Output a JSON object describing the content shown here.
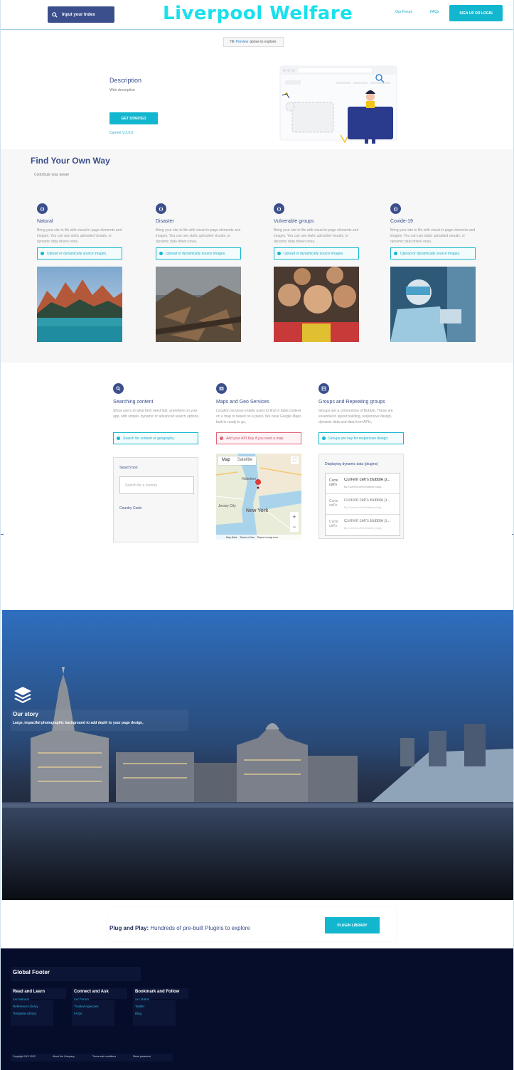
{
  "header": {
    "search_label": "Input your Index",
    "brand": "Liverpool Welfare",
    "nav": [
      "Our Forum",
      "FAQs"
    ],
    "signup_label": "SIGN UP OR LOGIN"
  },
  "notice": {
    "prefix": "Hit",
    "link": "Preview",
    "suffix": "above to explore."
  },
  "hero": {
    "title": "Description",
    "subtitle": "Web description",
    "button": "GET STARTED",
    "version": "Current V.3.0.0"
  },
  "find": {
    "title": "Find Your Own Way",
    "subtitle": "Contribute your power",
    "cards": [
      {
        "title": "Natural",
        "desc": "Bring your site to life with visual in-page elements and images, You can use static uploaded visuals, or dynamic data driven ones,",
        "info": "Upload or dynamically source images."
      },
      {
        "title": "Disaster",
        "desc": "Bring your site to life with visual in-page elements and images, You can use static uploaded visuals, or dynamic data driven ones,",
        "info": "Upload or dynamically source images."
      },
      {
        "title": "Vulnerable groups",
        "desc": "Bring your site to life with visual in-page elements and images, You can use static uploaded visuals, or dynamic data driven ones,",
        "info": "Upload or dynamically source images."
      },
      {
        "title": "Covide-19",
        "desc": "Bring your site to life with visual in-page elements and images, You can use static uploaded visuals, or dynamic data driven ones,",
        "info": "Upload or dynamically source images."
      }
    ]
  },
  "features": {
    "search": {
      "title": "Searching content",
      "desc": "Show users to what they need fast, anywhere on your app, with simple, dynamic or advanced search options,",
      "info": "Search for content or geography.",
      "box_label": "Search box:",
      "placeholder": "Search for a country",
      "country_label": "Country Code:"
    },
    "maps": {
      "title": "Maps and Geo Services",
      "desc": "Location services enable users to find or label content on a map or based on a place, We have Google Maps built in ready to go,",
      "warn": "Add your API Key if you need a map.",
      "tab_map": "Map",
      "tab_sat": "Satellite",
      "zoom_in": "+",
      "zoom_out": "−",
      "labels": {
        "hoboken": "Hoboken",
        "jersey": "Jersey City",
        "ny": "New York"
      },
      "footer": [
        "Map Data",
        "Terms of Use",
        "Report a map error"
      ]
    },
    "groups": {
      "title": "Groups and Repeating groups",
      "desc": "Groups are a cornerstone of Bubble, These are essential to layout building, responsive design, dynamic data and data from APIs,",
      "info": "Groups are key for responsive design.",
      "panel_title": "Displaying dynamic data (plugins)",
      "rows": [
        {
          "key": "Curre cell's",
          "title": "Current cell's Bubble p...",
          "sub": "By Current cell's Bubble plugi..."
        },
        {
          "key": "Curre cell's",
          "title": "Current cell's Bubble p...",
          "sub": "By Current cell's Bubble plugi..."
        },
        {
          "key": "Curre cell's",
          "title": "Current cell's Bubble p...",
          "sub": "By Current cell's Bubble plugi..."
        }
      ]
    }
  },
  "story": {
    "title": "Our story",
    "subtitle": "Large, impactful photographic background to add depth to your page design,"
  },
  "plug": {
    "bold": "Plug and Play:",
    "text": "Hundreds of pre-built Plugins to explore",
    "button": "PLUGIN LIBRARY"
  },
  "footer": {
    "title": "Global Footer",
    "columns": [
      {
        "heading": "Read and Learn",
        "links": [
          "xxx Manual",
          "Reference Library",
          "Template Library"
        ]
      },
      {
        "heading": "Connect and Ask",
        "links": [
          "xxx Forum",
          "Trusted Agencies",
          "FAQs"
        ]
      },
      {
        "heading": "Bookmark and Follow",
        "links": [
          "xxx status",
          "Twitter",
          "Blog"
        ]
      }
    ],
    "bottom": [
      "Copyright XXX 2022",
      "About the Company",
      "Terms and conditions",
      "Reset password"
    ]
  },
  "colors": {
    "primary": "#3b4f8c",
    "accent": "#12b7cf",
    "brand": "#19e0ec",
    "footer_bg": "#060d2b",
    "warn": "#e06478"
  }
}
